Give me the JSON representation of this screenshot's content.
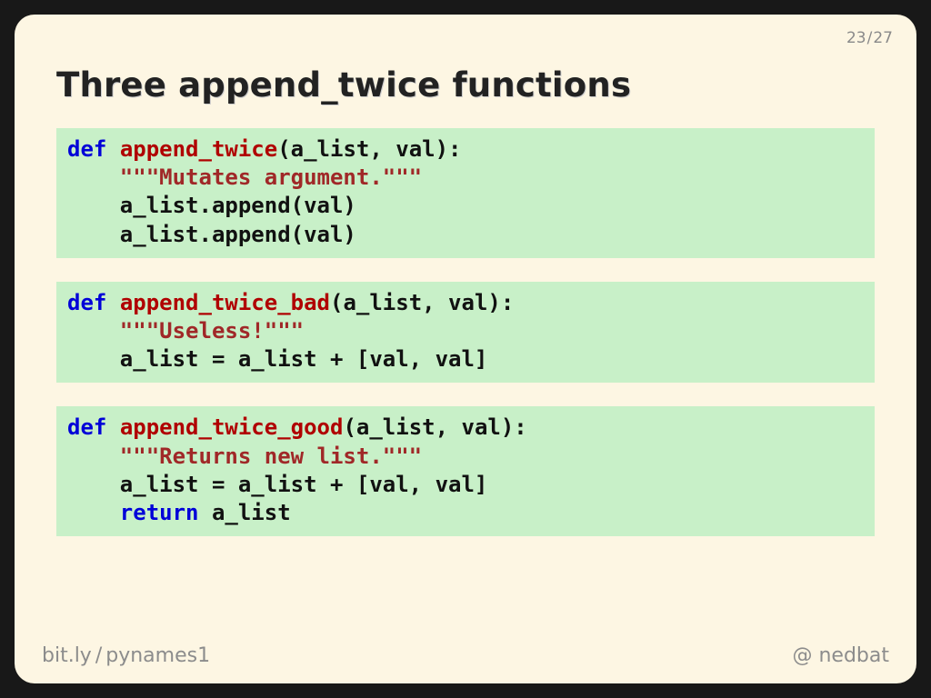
{
  "page": {
    "current": "23",
    "total": "27"
  },
  "title": "Three append_twice functions",
  "code": {
    "b1": {
      "def": "def",
      "name": "append_twice",
      "sig": "(a_list, val):",
      "doc": "\"\"\"Mutates argument.\"\"\"",
      "l3": "a_list.append(val)",
      "l4": "a_list.append(val)"
    },
    "b2": {
      "def": "def",
      "name": "append_twice_bad",
      "sig": "(a_list, val):",
      "doc": "\"\"\"Useless!\"\"\"",
      "l3": "a_list = a_list + [val, val]"
    },
    "b3": {
      "def": "def",
      "name": "append_twice_good",
      "sig": "(a_list, val):",
      "doc": "\"\"\"Returns new list.\"\"\"",
      "l3": "a_list = a_list + [val, val]",
      "ret": "return",
      "retexpr": " a_list"
    }
  },
  "footer": {
    "link_host": "bit.ly",
    "link_sep": "/",
    "link_path": "pynames1",
    "handle_at": "@",
    "handle_name": "nedbat"
  }
}
